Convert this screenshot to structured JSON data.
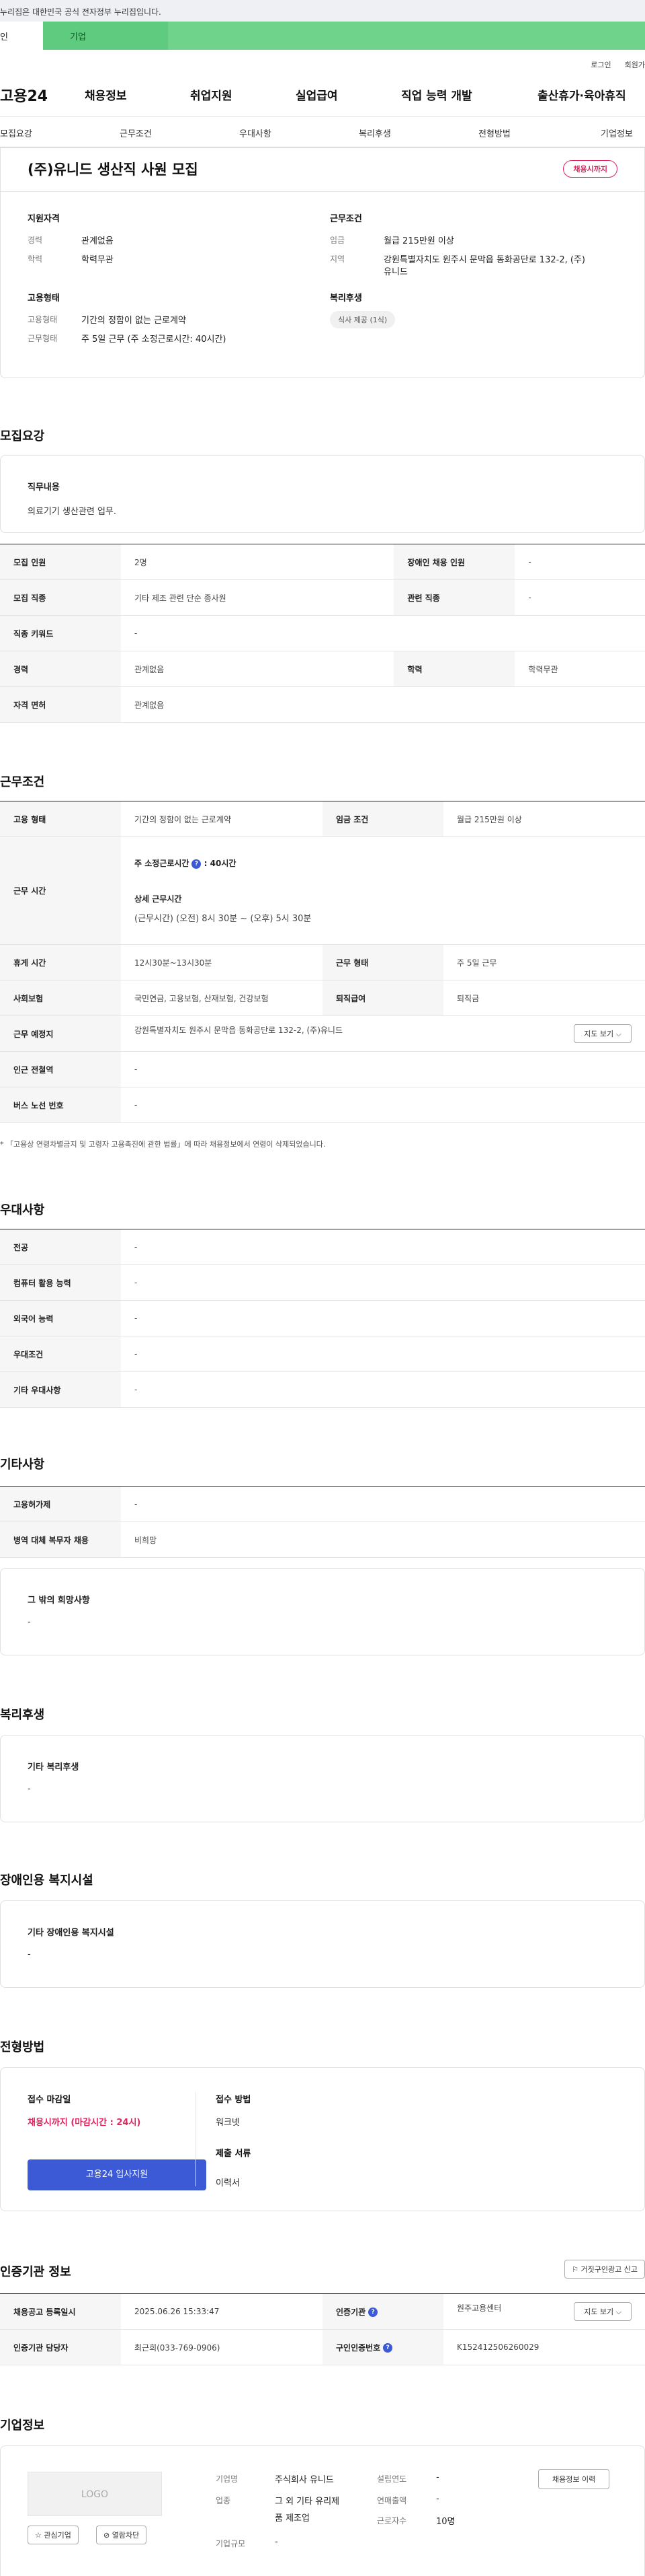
{
  "gov_banner": "누리집은 대한민국 공식 전자정부 누리집입니다.",
  "tabs": {
    "personal": "인",
    "company": "기업"
  },
  "util": {
    "login": "로그인",
    "signup": "회원가"
  },
  "logo": "고용24",
  "gnb": [
    "채용정보",
    "취업지원",
    "실업급여",
    "직업 능력 개발",
    "출산휴가·육아휴직"
  ],
  "anchors": [
    "모집요강",
    "근무조건",
    "우대사항",
    "복리후생",
    "전형방법",
    "기업정보"
  ],
  "job": {
    "title": "(주)유니드 생산직 사원 모집",
    "status_badge": "채용시까지",
    "qual_title": "지원자격",
    "qual": [
      {
        "label": "경력",
        "value": "관계없음"
      },
      {
        "label": "학력",
        "value": "학력무관"
      }
    ],
    "cond_title": "근무조건",
    "cond": [
      {
        "label": "임금",
        "value": "월급 215만원 이상"
      },
      {
        "label": "지역",
        "value": "강원특별자치도 원주시 문막읍 동화공단로 132-2, (주)",
        "value2": "유니드"
      }
    ],
    "emp_title": "고용형태",
    "emp": [
      {
        "label": "고용형태",
        "value": "기간의 정함이 없는 근로계약"
      },
      {
        "label": "근무형태",
        "value": "주 5일 근무 (주 소정근로시간: 40시간)"
      }
    ],
    "welfare_title": "복리후생",
    "welfare_pill": "식사 제공 (1식)"
  },
  "recruit": {
    "section": "모집요강",
    "duty_title": "직무내용",
    "duty_value": "의료기기 생산관련 업무.",
    "rows": {
      "count_h": "모집 인원",
      "count_v": "2명",
      "disabled_h": "장애인 채용 인원",
      "disabled_v": "-",
      "job_h": "모집 직종",
      "job_v": "기타 제조 관련 단순 종사원",
      "rel_h": "관련 직종",
      "rel_v": "-",
      "kw_h": "직종 키워드",
      "kw_v": "-",
      "career_h": "경력",
      "career_v": "관계없음",
      "edu_h": "학력",
      "edu_v": "학력무관",
      "license_h": "자격 면허",
      "license_v": "관계없음"
    }
  },
  "work": {
    "section": "근무조건",
    "emp_h": "고용 형태",
    "emp_v": "기간의 정함이 없는 근로계약",
    "wage_h": "임금 조건",
    "wage_v": "월급 215만원 이상",
    "time_h": "근무 시간",
    "time_l1": "주 소정근로시간",
    "time_l1_v": ": 40시간",
    "time_l2": "상세 근무시간",
    "time_l3": "(근무시간) (오전) 8시 30분 ~ (오후) 5시 30분",
    "break_h": "휴게 시간",
    "break_v": "12시30분~13시30분",
    "type_h": "근무 형태",
    "type_v": "주 5일 근무",
    "ins_h": "사회보험",
    "ins_v": "국민연금, 고용보험, 산재보험, 건강보험",
    "ret_h": "퇴직급여",
    "ret_v": "퇴직금",
    "loc_h": "근무 예정지",
    "loc_v": "강원특별자치도 원주시 문막읍 동화공단로 132-2, (주)유니드",
    "map_btn": "지도 보기",
    "sub_h": "인근 전철역",
    "sub_v": "-",
    "bus_h": "버스 노선 번호",
    "bus_v": "-",
    "note": "* 「고용상 연령차별금지 및 고령자 고용촉진에 관한 법률」에 따라 채용정보에서 연령이 삭제되었습니다."
  },
  "pref": {
    "section": "우대사항",
    "rows": [
      {
        "h": "전공",
        "v": "-"
      },
      {
        "h": "컴퓨터 활용 능력",
        "v": "-"
      },
      {
        "h": "외국어 능력",
        "v": "-"
      },
      {
        "h": "우대조건",
        "v": "-"
      },
      {
        "h": "기타 우대사항",
        "v": "-"
      }
    ]
  },
  "etc": {
    "section": "기타사항",
    "rows": [
      {
        "h": "고용허가제",
        "v": "-"
      },
      {
        "h": "병역 대체 복무자 채용",
        "v": "비희망"
      }
    ],
    "wish_title": "그 밖의 희망사항",
    "wish_value": "-"
  },
  "benefit": {
    "section": "복리후생",
    "title": "기타 복리후생",
    "value": "-"
  },
  "facility": {
    "section": "장애인용 복지시설",
    "title": "기타 장애인용 복지시설",
    "value": "-"
  },
  "process": {
    "section": "전형방법",
    "deadline_t": "접수 마감일",
    "deadline_v": "채용시까지 (마감시간 : 24시)",
    "method_t": "접수 방법",
    "method_v": "워크넷",
    "docs_t": "제출 서류",
    "docs_v": "이력서",
    "apply": "고용24 입사지원"
  },
  "cert": {
    "section": "인증기관 정보",
    "report": "거짓구인광고 신고",
    "reg_h": "채용공고 등록일시",
    "reg_v": "2025.06.26 15:33:47",
    "org_h": "인증기관",
    "org_v": "원주고용센터",
    "map_btn": "지도 보기",
    "mgr_h": "인증기관 담당자",
    "mgr_v": "최근희(033-769-0906)",
    "num_h": "구인인증번호",
    "num_v": "K152412506260029"
  },
  "company": {
    "section": "기업정보",
    "logo_text": "LOGO",
    "fav": "관심기업",
    "block": "열람차단",
    "name_l": "기업명",
    "name_v": "주식회사 유니드",
    "ind_l": "업종",
    "ind_v1": "그 외 기타 유리제",
    "ind_v2": "품 제조업",
    "size_l": "기업규모",
    "size_v": "-",
    "est_l": "설립연도",
    "est_v": "-",
    "sales_l": "연매출액",
    "sales_v": "-",
    "emp_l": "근로자수",
    "emp_v": "10명",
    "history": "채용정보 이력"
  }
}
